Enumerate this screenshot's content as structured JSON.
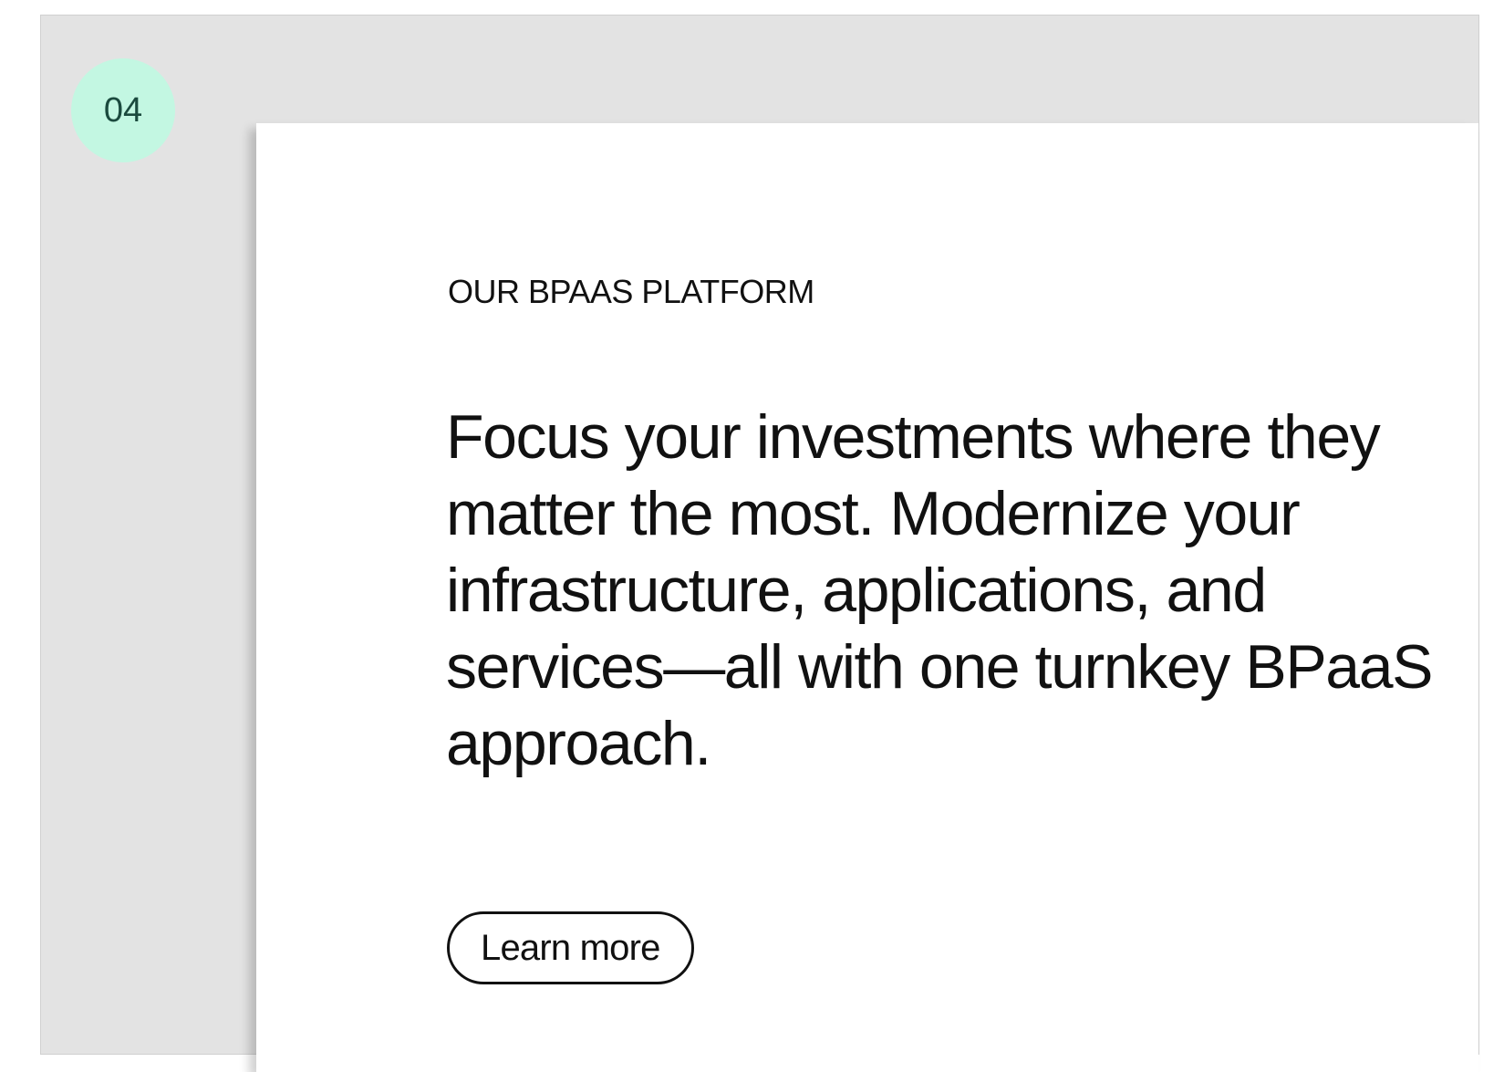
{
  "step": {
    "number": "04"
  },
  "section": {
    "eyebrow": "OUR BPAAS PLATFORM",
    "headline": "Focus your investments where they matter the most. Modernize your infrastructure, applications, and services—all with one turnkey BPaaS approach.",
    "cta_label": "Learn more"
  },
  "colors": {
    "background": "#e3e3e3",
    "card": "#ffffff",
    "badge": "#c3f7e2",
    "badge_text": "#1b4a3e",
    "text": "#111111"
  }
}
